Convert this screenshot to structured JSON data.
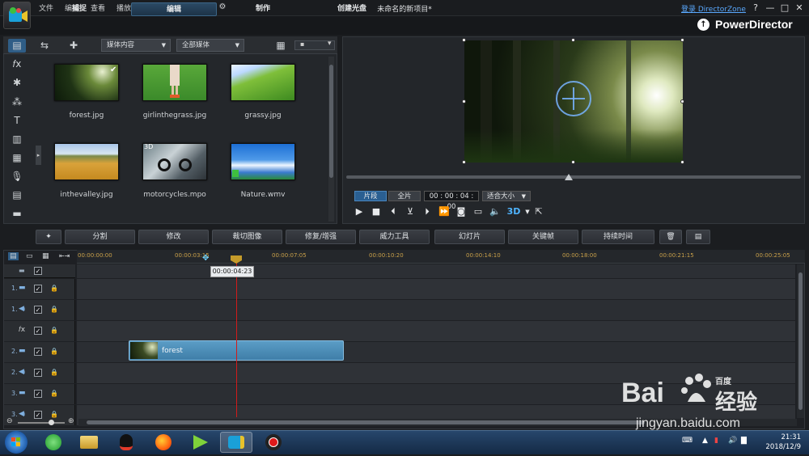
{
  "title_bar": {
    "menus": [
      "文件",
      "编辑",
      "查看",
      "播放"
    ],
    "window_title": "未命名的新项目*",
    "login_link": "登录 DirectorZone",
    "help": "?",
    "minimize": "—",
    "maximize": "□",
    "close": "✕"
  },
  "tabs": [
    {
      "label": "捕捉"
    },
    {
      "label": "编辑"
    },
    {
      "label": "制作"
    },
    {
      "label": "创建光盘"
    }
  ],
  "brand": "PowerDirector",
  "library": {
    "filter_dropdown": "媒体内容",
    "media_dropdown": "全部媒体",
    "items": [
      {
        "label": "forest.jpg"
      },
      {
        "label": "girlinthegrass.jpg"
      },
      {
        "label": "grassy.jpg"
      },
      {
        "label": "inthevalley.jpg"
      },
      {
        "label": "motorcycles.mpo"
      },
      {
        "label": "Nature.wmv"
      }
    ],
    "badge_3d": "3D"
  },
  "preview": {
    "mode_clip": "片段",
    "mode_movie": "全片",
    "timecode": "00 : 00 : 04 : 00",
    "fit": "适合大小",
    "mode_3d": "3D",
    "seek_position_fraction": 0.49
  },
  "toolbar": [
    "分割",
    "修改",
    "裁切图像",
    "修复/增强",
    "威力工具",
    "幻灯片",
    "关键帧",
    "持续时间"
  ],
  "timeline": {
    "ticks": [
      "00:00:00:00",
      "00:00:03:15",
      "00:00:07:05",
      "00:00:10:20",
      "00:00:14:10",
      "00:00:18:00",
      "00:00:21:15",
      "00:00:25:05"
    ],
    "playhead_tooltip": "00:00:04:23",
    "tracks": [
      {
        "num": "1.",
        "type": "video"
      },
      {
        "num": "1.",
        "type": "audio"
      },
      {
        "num": "",
        "type": "fx"
      },
      {
        "num": "2.",
        "type": "video"
      },
      {
        "num": "2.",
        "type": "audio"
      },
      {
        "num": "3.",
        "type": "video"
      },
      {
        "num": "3.",
        "type": "audio"
      }
    ],
    "clip_label": "forest"
  },
  "taskbar": {
    "time": "21:31",
    "date": "2018/12/9"
  },
  "watermark": {
    "brand": "Bai",
    "brand2": "百度",
    "tagline": "经验",
    "url": "jingyan.baidu.com"
  },
  "colors": {
    "accent": "#3f7ea8",
    "playhead": "#d21b1b",
    "tick": "#c9a04a"
  }
}
